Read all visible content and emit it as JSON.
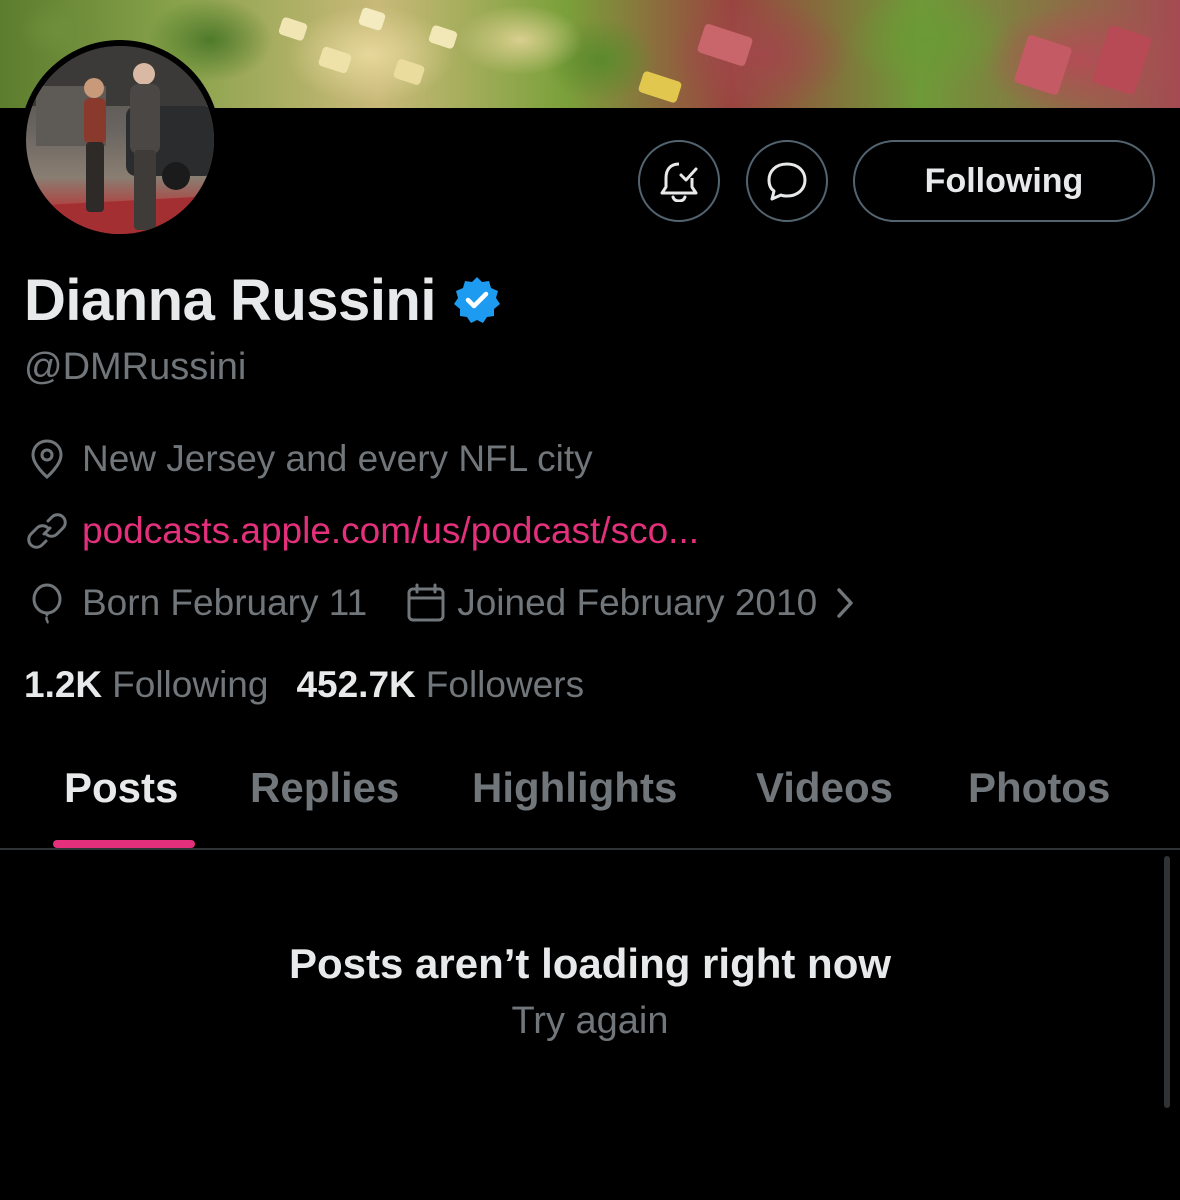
{
  "profile": {
    "display_name": "Dianna Russini",
    "handle": "@DMRussini",
    "location": "New Jersey and every NFL city",
    "website": "podcasts.apple.com/us/podcast/sco...",
    "birthday": "Born February 11",
    "joined": "Joined February 2010",
    "verified_color": "#1d9bf0"
  },
  "actions": {
    "notifications_icon": "bell-check-icon",
    "message_icon": "message-bubble-icon",
    "follow_label": "Following"
  },
  "stats": {
    "following_count": "1.2K",
    "following_label": "Following",
    "followers_count": "452.7K",
    "followers_label": "Followers"
  },
  "tabs": [
    {
      "label": "Posts",
      "active": true
    },
    {
      "label": "Replies",
      "active": false
    },
    {
      "label": "Highlights",
      "active": false
    },
    {
      "label": "Videos",
      "active": false
    },
    {
      "label": "Photos",
      "active": false
    }
  ],
  "feed": {
    "error_title": "Posts aren’t loading right now",
    "retry_label": "Try again"
  },
  "colors": {
    "accent": "#e4307c",
    "background": "#000000",
    "text_primary": "#e7e9ea",
    "text_secondary": "#71767b",
    "border": "#536471"
  }
}
